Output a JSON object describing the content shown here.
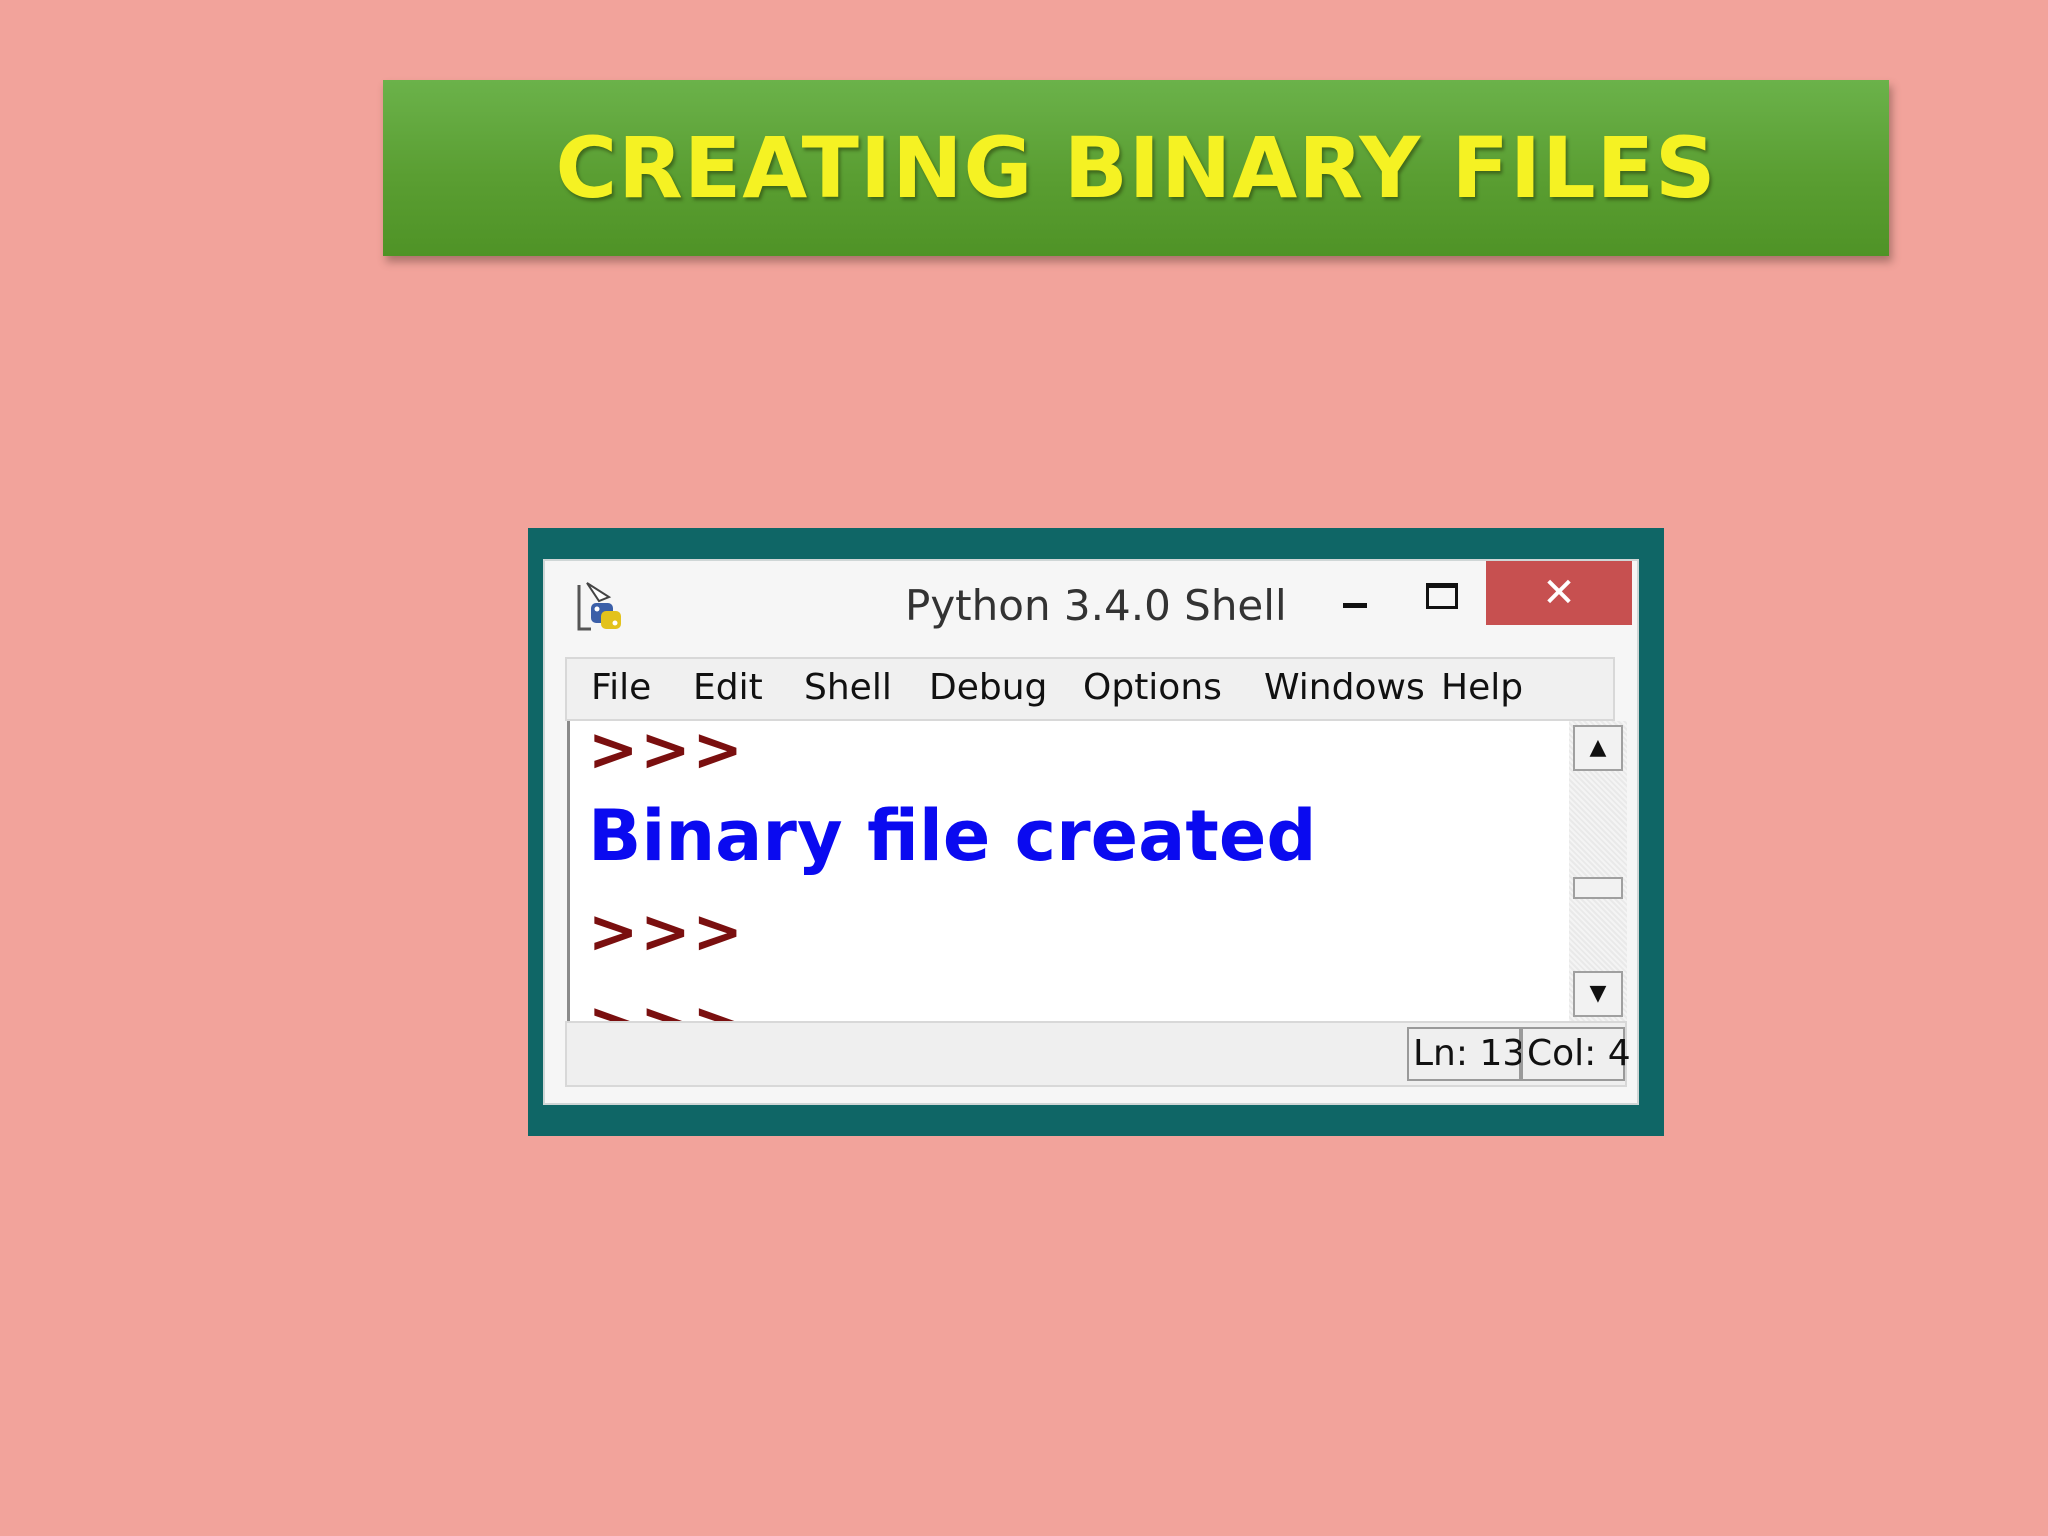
{
  "slide": {
    "title": "CREATING BINARY FILES"
  },
  "window": {
    "title": "Python 3.4.0 Shell",
    "icon": "python-idle-icon",
    "close_label": "✕"
  },
  "menu": {
    "items": [
      "File",
      "Edit",
      "Shell",
      "Debug",
      "Options",
      "Windows",
      "Help"
    ]
  },
  "shell": {
    "lines": [
      {
        "type": "prompt",
        "text": ">>>"
      },
      {
        "type": "output",
        "text": "Binary file created"
      },
      {
        "type": "prompt",
        "text": ">>>"
      },
      {
        "type": "prompt",
        "text": ">>>"
      }
    ]
  },
  "scrollbar": {
    "up_icon": "▲",
    "down_icon": "▼"
  },
  "status": {
    "line": "Ln: 13",
    "col": "Col: 4"
  },
  "colors": {
    "background": "#f2a39b",
    "banner": "#5a9e32",
    "banner_text": "#f5f223",
    "frame": "#0f6666",
    "close_button": "#c75050",
    "prompt": "#7a0f0f",
    "output": "#0a0af0"
  }
}
